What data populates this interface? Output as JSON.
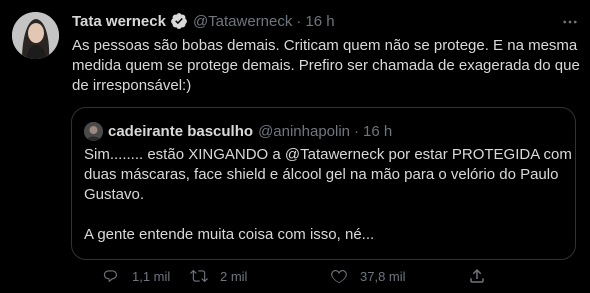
{
  "tweet": {
    "author_name": "Tata werneck",
    "author_handle": "@Tatawerneck",
    "separator": "·",
    "time": "16 h",
    "text_lines": [
      "As pessoas são bobas demais. Criticam quem não se protege. E na mesma",
      "medida quem se protege demais. Prefiro ser chamada de exagerada do que",
      "de irresponsável:)"
    ],
    "icons": {
      "verified": "verified-badge-icon",
      "more": "more-options-icon"
    }
  },
  "quote": {
    "author_name": "cadeirante basculho",
    "author_handle": "@aninhapolin",
    "separator": "·",
    "time": "16 h",
    "text_lines": [
      "Sim........ estão XINGANDO a @Tatawerneck por estar PROTEGIDA com",
      "duas máscaras, face shield e álcool gel na mão para o velório do Paulo",
      "Gustavo.",
      "",
      "A gente entende muita coisa com isso, né..."
    ]
  },
  "actions": {
    "reply_count": "1,1 mil",
    "retweet_count": "2 mil",
    "like_count": "37,8 mil",
    "icons": [
      "reply-icon",
      "retweet-icon",
      "like-icon",
      "share-icon"
    ]
  },
  "colors": {
    "background": "#000000",
    "text": "#d9d9d9",
    "secondary": "#6e767d",
    "border": "#2f3336",
    "verified": "#1d9bf0"
  }
}
